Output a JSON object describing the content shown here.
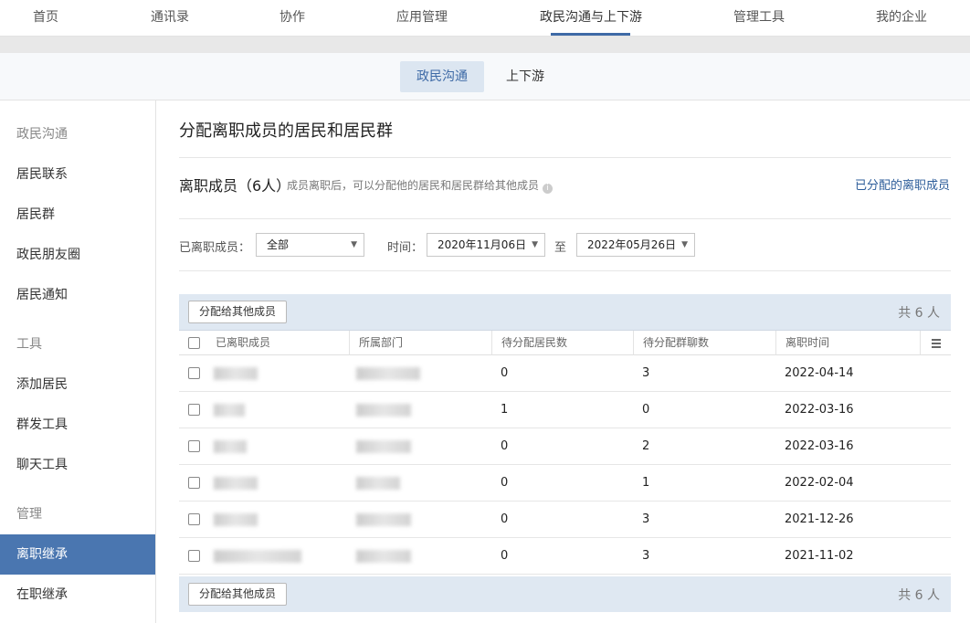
{
  "topnav": {
    "items": [
      {
        "label": "首页"
      },
      {
        "label": "通讯录"
      },
      {
        "label": "协作"
      },
      {
        "label": "应用管理"
      },
      {
        "label": "政民沟通与上下游"
      },
      {
        "label": "管理工具"
      },
      {
        "label": "我的企业"
      }
    ],
    "active_index": 4
  },
  "subtabs": [
    {
      "label": "政民沟通"
    },
    {
      "label": "上下游"
    }
  ],
  "sidebar": {
    "items": [
      {
        "label": "政民沟通",
        "type": "section"
      },
      {
        "label": "居民联系"
      },
      {
        "label": "居民群"
      },
      {
        "label": "政民朋友圈"
      },
      {
        "label": "居民通知"
      },
      {
        "label": "工具",
        "type": "section"
      },
      {
        "label": "添加居民"
      },
      {
        "label": "群发工具"
      },
      {
        "label": "聊天工具"
      },
      {
        "label": "管理",
        "type": "section"
      },
      {
        "label": "离职继承",
        "active": true
      },
      {
        "label": "在职继承"
      }
    ]
  },
  "main": {
    "title": "分配离职成员的居民和居民群",
    "members_title": "离职成员（6人）",
    "members_hint": "成员离职后，可以分配他的居民和居民群给其他成员",
    "assigned_link": "已分配的离职成员",
    "filters": {
      "member_label": "已离职成员：",
      "member_value": "全部",
      "time_label": "时间：",
      "date_from": "2020年11月06日",
      "to_label": "至",
      "date_to": "2022年05月26日"
    },
    "assign_button": "分配给其他成员",
    "total": "共 6 人",
    "columns": [
      "已离职成员",
      "所属部门",
      "待分配居民数",
      "待分配群聊数",
      "离职时间"
    ],
    "rows": [
      {
        "residents": "0",
        "groups": "3",
        "date": "2022-04-14"
      },
      {
        "residents": "1",
        "groups": "0",
        "date": "2022-03-16"
      },
      {
        "residents": "0",
        "groups": "2",
        "date": "2022-03-16"
      },
      {
        "residents": "0",
        "groups": "1",
        "date": "2022-02-04"
      },
      {
        "residents": "0",
        "groups": "3",
        "date": "2021-12-26"
      },
      {
        "residents": "0",
        "groups": "3",
        "date": "2021-11-02"
      }
    ]
  },
  "colors": {
    "accent": "#4a76b0",
    "link": "#2d5d9a",
    "toolbar_bg": "#dfe8f2"
  }
}
